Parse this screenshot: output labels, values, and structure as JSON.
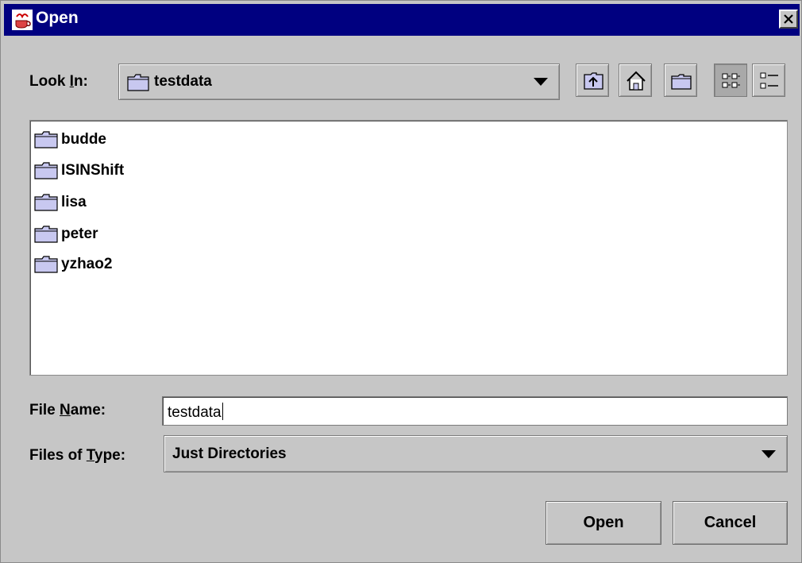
{
  "window": {
    "title": "Open",
    "close_label": "✕"
  },
  "look_in": {
    "label_prefix": "Look ",
    "label_mnemonic": "I",
    "label_suffix": "n:",
    "value": "testdata"
  },
  "toolbar": {
    "buttons": [
      {
        "name": "up-one-level",
        "icon": "folder-up-icon"
      },
      {
        "name": "home",
        "icon": "home-icon"
      },
      {
        "name": "new-folder",
        "icon": "new-folder-icon"
      },
      {
        "name": "list-view",
        "icon": "list-view-icon",
        "pressed": true
      },
      {
        "name": "details-view",
        "icon": "details-view-icon"
      }
    ]
  },
  "files": [
    {
      "name": "budde",
      "icon": "folder-icon"
    },
    {
      "name": "ISINShift",
      "icon": "folder-icon"
    },
    {
      "name": "lisa",
      "icon": "folder-icon"
    },
    {
      "name": "peter",
      "icon": "folder-icon"
    },
    {
      "name": "yzhao2",
      "icon": "folder-icon"
    }
  ],
  "file_name": {
    "label_prefix": "File ",
    "label_mnemonic": "N",
    "label_suffix": "ame:",
    "value": "testdata"
  },
  "files_of_type": {
    "label_prefix": "Files of ",
    "label_mnemonic": "T",
    "label_suffix": "ype:",
    "value": "Just Directories"
  },
  "buttons": {
    "open": "Open",
    "cancel": "Cancel"
  },
  "colors": {
    "titlebar": "#000080",
    "dialog_bg": "#c6c6c6",
    "folder_fill": "#c8c8f0"
  }
}
